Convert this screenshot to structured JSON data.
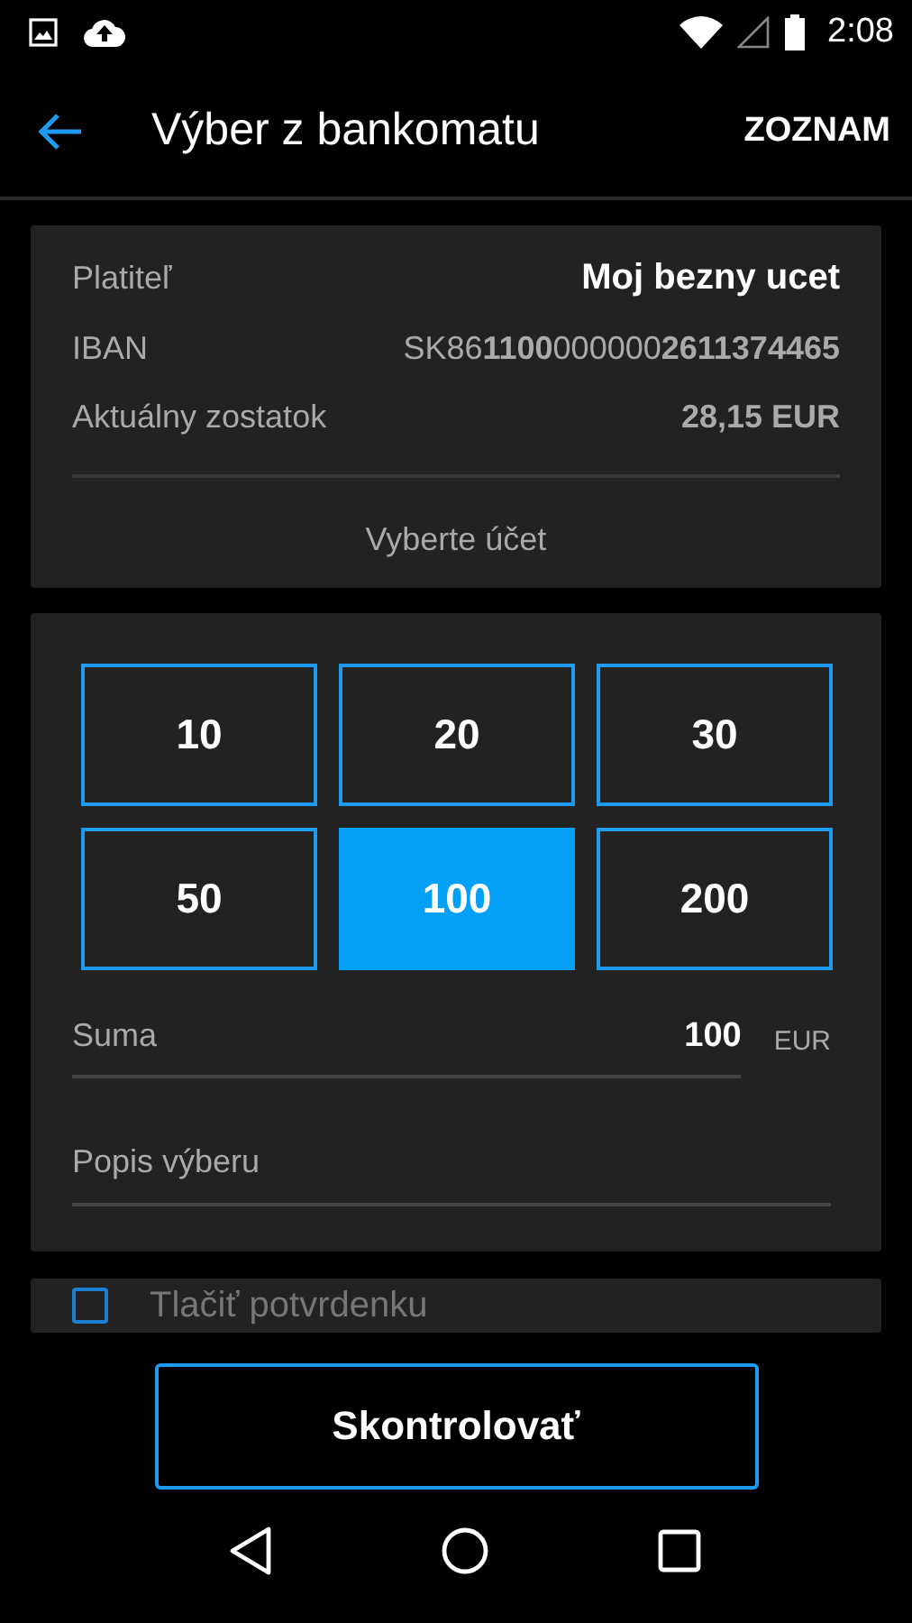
{
  "status_bar": {
    "time": "2:08"
  },
  "app_bar": {
    "title": "Výber z bankomatu",
    "action": "ZOZNAM"
  },
  "account": {
    "rows": [
      {
        "label": "Platiteľ",
        "value": "Moj bezny ucet",
        "kind": "name"
      },
      {
        "label": "IBAN",
        "value": "SK86**1100**000000**2611374465**",
        "kind": "iban"
      },
      {
        "label": "Aktuálny zostatok",
        "value": "28,15 EUR",
        "kind": "balance"
      }
    ],
    "select_link": "Vyberte účet"
  },
  "amounts": [
    {
      "label": "10",
      "selected": false
    },
    {
      "label": "20",
      "selected": false
    },
    {
      "label": "30",
      "selected": false
    },
    {
      "label": "50",
      "selected": false
    },
    {
      "label": "100",
      "selected": true
    },
    {
      "label": "200",
      "selected": false
    }
  ],
  "amount_field": {
    "label": "Suma",
    "value": "100",
    "currency": "EUR"
  },
  "description_field": {
    "placeholder": "Popis výberu"
  },
  "print_receipt": {
    "label": "Tlačiť potvrdenku",
    "checked": false
  },
  "submit_button": "Skontrolovať"
}
